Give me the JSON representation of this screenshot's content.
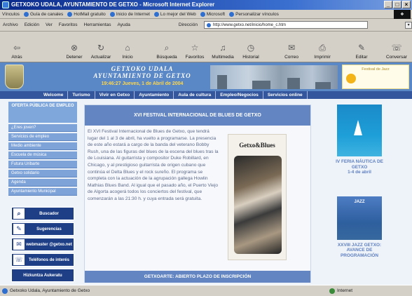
{
  "window": {
    "title": "GETXOKO UDALA, AYUNTAMIENTO DE GETXO - Microsoft Internet Explorer"
  },
  "links_bar": {
    "label": "Vínculos",
    "items": [
      "Guía de canales",
      "HotMail gratuito",
      "Inicio de Internet",
      "Lo mejor del Web",
      "Microsoft",
      "Personalizar vínculos"
    ]
  },
  "menu": {
    "items": [
      "Archivo",
      "Edición",
      "Ver",
      "Favoritos",
      "Herramientas",
      "Ayuda"
    ],
    "address_label": "Dirección",
    "address": "http://www.getxo.net/inicio/home_c.htm"
  },
  "toolbar": {
    "buttons": [
      "Atrás",
      "Detener",
      "Actualizar",
      "Inicio",
      "Búsqueda",
      "Favoritos",
      "Multimedia",
      "Historial",
      "Correo",
      "Imprimir",
      "Editar",
      "Conversar"
    ]
  },
  "banner": {
    "title_line1": "GETXOKO UDALA",
    "title_line2": "AYUNTAMIENTO DE GETXO",
    "date": "19:46:27 Jueves, 1 de Abril de 2004",
    "promo": "Festival de Jazz"
  },
  "nav": {
    "items": [
      "Welcome",
      "Turismo",
      "Vivir en Getxo",
      "Ayuntamiento",
      "Aula de cultura",
      "Empleo/Negocios",
      "Servicios online"
    ]
  },
  "sidebar": {
    "header": "OFERTA PÚBLICA DE EMPLEO",
    "items": [
      "¿Eres joven?",
      "Servicios de empleo",
      "Medio ambiente",
      "Escuela de música",
      "Futura Uribarte",
      "Getxo solidario",
      "Agenda",
      "Ayuntamiento Municipal"
    ],
    "buttons": [
      {
        "label": "Buscador",
        "icon": "search-icon"
      },
      {
        "label": "Sugerencias",
        "icon": "pencil-icon"
      },
      {
        "label": "webmaster @getxo.net",
        "icon": "mail-icon"
      },
      {
        "label": "Teléfonos de interés",
        "icon": "phone-icon"
      }
    ],
    "bottom_button": "Hizkuntza Aukeratu"
  },
  "content": {
    "heading": "XVI FESTIVAL INTERNACIONAL DE BLUES DE GETXO",
    "body": "El XVI Festival Internacional de Blues de Getxo, que tendrá lugar del 1 al 3 de abril, ha vuelto a programarse. La presencia de este año estará a cargo de la banda del veterano Bobby Rush, una de las figuras del blues de la escena del blues tras la de Louisiana. Al guitarrista y compositor Duke Robillard, en Chicago, y al prestigioso guitarrista de origen cubano que continúa el Delta Blues y el rock sureño. El programa se completa con la actuación de la agrupación gallega Howlin Mathias Blues Band. Al igual que el pasado año, el Puerto Viejo de Algorta acogerá todos los conciertos del festival, que comenzarán a las 21:30 h. y cuya entrada será gratuita.",
    "poster_title": "Getxo&Blues",
    "footer": "GETXOARTE: ABIERTO PLAZO DE INSCRIPCIÓN"
  },
  "right_column": {
    "boat_caption": [
      "IV FERIA NÁUTICA DE",
      "GETXO",
      "1-4 de abril"
    ],
    "jazz_label": "JAZZ",
    "jazz_caption": [
      "XXVIII JAZZ GETXO:",
      "AVANCE DE",
      "PROGRAMACIÓN"
    ]
  },
  "statusbar": {
    "text": "Getxoko Udala, Ayuntamiento de Getxo",
    "zone": "Internet"
  }
}
